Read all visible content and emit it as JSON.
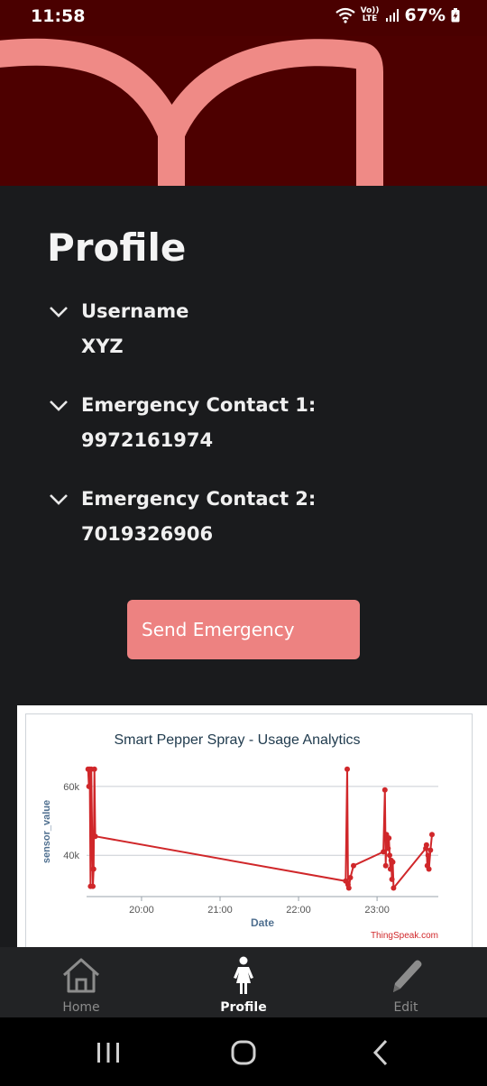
{
  "status_bar": {
    "time": "11:58",
    "network_top": "Vo))",
    "network_bottom": "LTE",
    "battery": "67%"
  },
  "page": {
    "title": "Profile"
  },
  "fields": [
    {
      "label": "Username",
      "value": "XYZ"
    },
    {
      "label": "Emergency Contact 1:",
      "value": "9972161974"
    },
    {
      "label": "Emergency Contact 2:",
      "value": "7019326906"
    }
  ],
  "actions": {
    "emergency_label": "Send Emergency"
  },
  "colors": {
    "accent": "#ed8281",
    "hero_bg": "#4d0000",
    "background": "#1a1b1d",
    "series": "#d0272a"
  },
  "chart_data": {
    "type": "line",
    "title": "Smart Pepper Spray - Usage Analytics",
    "xlabel": "Date",
    "ylabel": "sensor_value",
    "x_ticks": [
      "20:00",
      "21:00",
      "22:00",
      "23:00"
    ],
    "y_ticks": [
      "40k",
      "60k"
    ],
    "y_tick_values": [
      40000,
      60000
    ],
    "xlim": [
      19.3,
      23.78
    ],
    "ylim": [
      28000,
      66000
    ],
    "grid": "horizontal",
    "footer": "ThingSpeak.com",
    "series": [
      {
        "values": [
          [
            19.32,
            65000
          ],
          [
            19.33,
            60000
          ],
          [
            19.34,
            65000
          ],
          [
            19.35,
            31000
          ],
          [
            19.36,
            65000
          ],
          [
            19.38,
            31000
          ],
          [
            19.39,
            36000
          ],
          [
            19.4,
            65000
          ],
          [
            19.41,
            45500
          ],
          [
            22.6,
            32500
          ],
          [
            22.62,
            65000
          ],
          [
            22.63,
            31500
          ],
          [
            22.64,
            30500
          ],
          [
            22.66,
            33500
          ],
          [
            22.7,
            37000
          ],
          [
            23.08,
            41000
          ],
          [
            23.1,
            59000
          ],
          [
            23.11,
            37000
          ],
          [
            23.12,
            46000
          ],
          [
            23.13,
            43000
          ],
          [
            23.14,
            42000
          ],
          [
            23.15,
            45000
          ],
          [
            23.16,
            40000
          ],
          [
            23.17,
            36000
          ],
          [
            23.18,
            38500
          ],
          [
            23.19,
            33000
          ],
          [
            23.2,
            38000
          ],
          [
            23.21,
            30500
          ],
          [
            23.62,
            42000
          ],
          [
            23.63,
            43000
          ],
          [
            23.64,
            37000
          ],
          [
            23.65,
            40000
          ],
          [
            23.66,
            36000
          ],
          [
            23.68,
            41500
          ],
          [
            23.7,
            46000
          ]
        ]
      }
    ]
  },
  "bottom_nav": [
    {
      "label": "Home",
      "icon": "home-icon"
    },
    {
      "label": "Profile",
      "icon": "person-icon"
    },
    {
      "label": "Edit",
      "icon": "pencil-icon"
    }
  ],
  "system_nav": {
    "icons": [
      "recents-icon",
      "home-circle-icon",
      "back-icon"
    ]
  }
}
